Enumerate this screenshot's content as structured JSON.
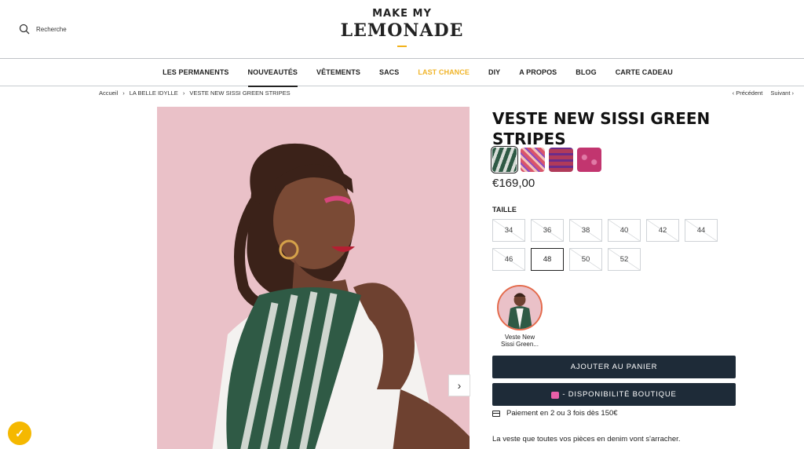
{
  "header": {
    "search_label": "Recherche",
    "logo_line1": "MAKE MY",
    "logo_line2": "LEMONADE"
  },
  "nav": {
    "items": [
      {
        "label": "LES PERMANENTS"
      },
      {
        "label": "NOUVEAUTÉS",
        "active": true
      },
      {
        "label": "VÊTEMENTS"
      },
      {
        "label": "SACS"
      },
      {
        "label": "LAST CHANCE",
        "color": "#f0b429"
      },
      {
        "label": "DIY"
      },
      {
        "label": "A PROPOS"
      },
      {
        "label": "BLOG"
      },
      {
        "label": "CARTE CADEAU"
      }
    ]
  },
  "breadcrumb": {
    "items": [
      "Accueil",
      "LA BELLE IDYLLE",
      "VESTE NEW SISSI GREEN STRIPES"
    ],
    "sep": "›",
    "prev": "‹ Précédent",
    "next": "Suivant ›"
  },
  "product": {
    "title": "VESTE NEW SISSI GREEN STRIPES",
    "price": "€169,00",
    "size_label": "TAILLE",
    "sizes": [
      {
        "label": "34",
        "available": false
      },
      {
        "label": "36",
        "available": false
      },
      {
        "label": "38",
        "available": false
      },
      {
        "label": "40",
        "available": false
      },
      {
        "label": "42",
        "available": false
      },
      {
        "label": "44",
        "available": false
      },
      {
        "label": "46",
        "available": false
      },
      {
        "label": "48",
        "available": true
      },
      {
        "label": "50",
        "available": false
      },
      {
        "label": "52",
        "available": false
      }
    ],
    "swatch_colors": [
      "#2f5a45",
      "#d9556b",
      "#b03a5a",
      "#c2356f"
    ],
    "look_label_line1": "Veste New",
    "look_label_line2": "Sissi Green...",
    "add_to_cart": "AJOUTER AU PANIER",
    "store_availability": "- DISPONIBILITÉ BOUTIQUE",
    "payment_note": "Paiement en 2 ou 3 fois dès 150€",
    "description": "La veste que toutes vos pièces en denim vont s'arracher."
  },
  "colors": {
    "navy": "#1e2b38",
    "accent_yellow": "#f0b429",
    "photo_bg": "#eac1c8"
  },
  "icons": {
    "search": "search-icon",
    "next_image": "chevron-right-icon",
    "payment": "credit-card-icon",
    "store": "shopping-bag-icon",
    "badge": "checkmark-icon"
  }
}
